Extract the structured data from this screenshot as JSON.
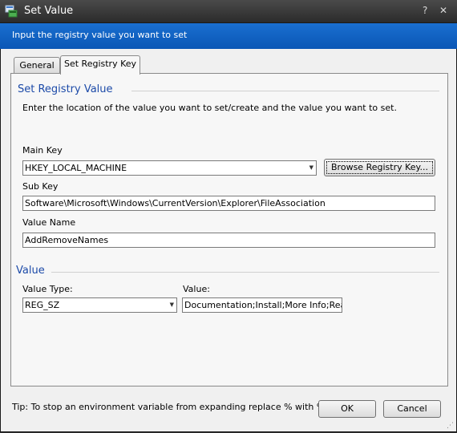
{
  "window": {
    "title": "Set Value",
    "help_glyph": "?",
    "close_glyph": "✕"
  },
  "banner": {
    "text": "Input the registry value you want to set"
  },
  "tabs": [
    {
      "label": "General",
      "active": false
    },
    {
      "label": "Set Registry Key",
      "active": true
    }
  ],
  "registry_section": {
    "title": "Set Registry Value",
    "instructions": "Enter the location of the value you want to set/create and the value you want to set.",
    "main_key_label": "Main Key",
    "main_key_value": "HKEY_LOCAL_MACHINE",
    "browse_label": "Browse Registry Key...",
    "sub_key_label": "Sub Key",
    "sub_key_value": "Software\\Microsoft\\Windows\\CurrentVersion\\Explorer\\FileAssociation",
    "value_name_label": "Value Name",
    "value_name_value": "AddRemoveNames"
  },
  "value_section": {
    "title": "Value",
    "type_label": "Value Type:",
    "type_value": "REG_SZ",
    "value_label": "Value:",
    "value_value": "Documentation;Install;More Info;Readme"
  },
  "footer": {
    "tip": "Tip: To stop an environment variable from expanding replace % with %%.",
    "ok_label": "OK",
    "cancel_label": "Cancel"
  },
  "colors": {
    "banner": "#0a56b5",
    "section_title": "#1c4aa8",
    "titlebar": "#2b2b2b"
  },
  "icons": [
    "registry-app-icon",
    "help-icon",
    "close-icon",
    "dropdown-arrow-icon",
    "resize-grip-icon"
  ]
}
